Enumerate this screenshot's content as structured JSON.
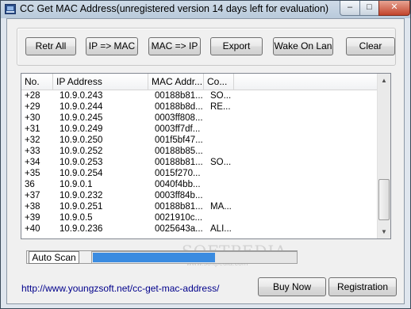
{
  "window": {
    "title": "CC Get MAC Address(unregistered version 14 days left for evaluation)",
    "min_glyph": "–",
    "max_glyph": "□",
    "close_glyph": "✕"
  },
  "toolbar": {
    "retr_all": "Retr All",
    "ip_to_mac": "IP => MAC",
    "mac_to_ip": "MAC => IP",
    "export": "Export",
    "wake_on_lan": "Wake On Lan",
    "clear": "Clear"
  },
  "list": {
    "columns": [
      "No.",
      "IP Address",
      "MAC Addr...",
      "Co..."
    ],
    "rows": [
      [
        "+28",
        "10.9.0.243",
        "00188b81...",
        "SO..."
      ],
      [
        "+29",
        "10.9.0.244",
        "00188b8d...",
        "RE..."
      ],
      [
        "+30",
        "10.9.0.245",
        "0003ff808...",
        ""
      ],
      [
        "+31",
        "10.9.0.249",
        "0003ff7df...",
        ""
      ],
      [
        "+32",
        "10.9.0.250",
        "001f5bf47...",
        ""
      ],
      [
        "+33",
        "10.9.0.252",
        "00188b85...",
        ""
      ],
      [
        "+34",
        "10.9.0.253",
        "00188b81...",
        "SO..."
      ],
      [
        "+35",
        "10.9.0.254",
        "0015f270...",
        ""
      ],
      [
        "36",
        "10.9.0.1",
        "0040f4bb...",
        ""
      ],
      [
        "+37",
        "10.9.0.232",
        "0003ff84b...",
        ""
      ],
      [
        "+38",
        "10.9.0.251",
        "00188b81...",
        "MA..."
      ],
      [
        "+39",
        "10.9.0.5",
        "0021910c...",
        ""
      ],
      [
        "+40",
        "10.9.0.236",
        "0025643a...",
        "ALI..."
      ]
    ],
    "scroll_up_glyph": "▲",
    "scroll_down_glyph": "▼"
  },
  "scan": {
    "auto_scan_label": "Auto Scan",
    "progress_fraction": 0.6
  },
  "footer": {
    "url": "http://www.youngzsoft.net/cc-get-mac-address/",
    "buy_now": "Buy Now",
    "registration": "Registration"
  },
  "watermark": {
    "text": "SOFTPEDIA",
    "sub": "www.softpedia.com"
  },
  "colors": {
    "progress": "#3a8be0",
    "link": "#00008b"
  },
  "icons": [
    "app-icon",
    "minimize-icon",
    "maximize-icon",
    "close-icon",
    "scroll-up-icon",
    "scroll-down-icon"
  ]
}
